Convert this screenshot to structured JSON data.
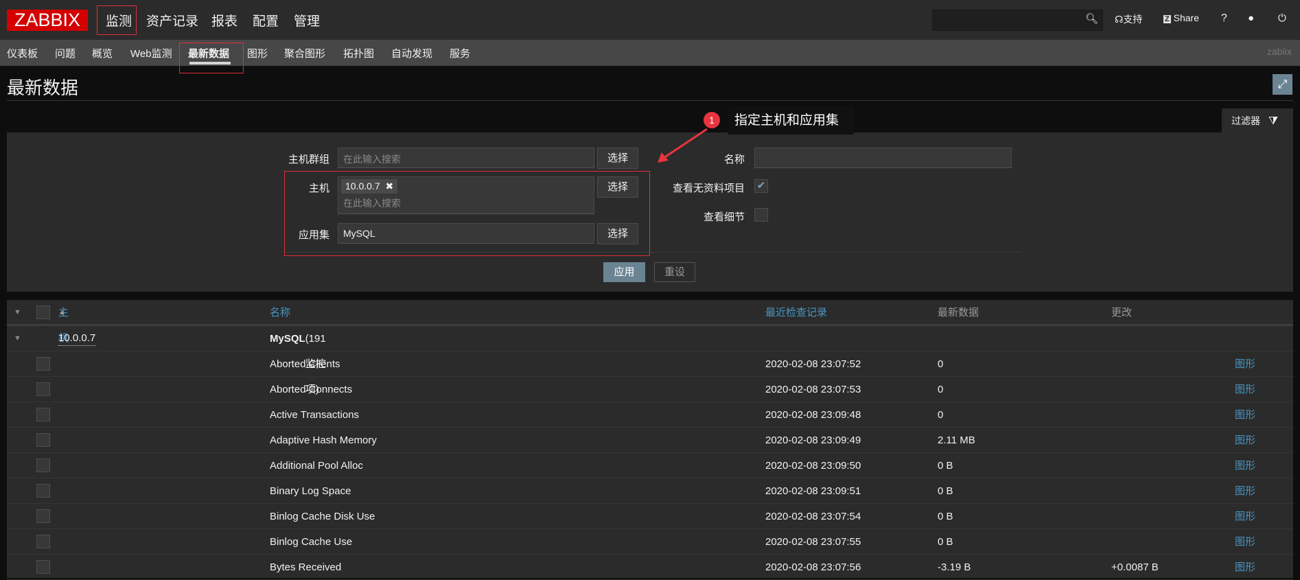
{
  "topbar": {
    "logo": "ZABBIX",
    "menu": [
      "监测",
      "资产记录",
      "报表",
      "配置",
      "管理"
    ],
    "support": "支持",
    "share": "Share",
    "help": "?"
  },
  "subnav": {
    "items": [
      "仪表板",
      "问题",
      "概览",
      "Web监测",
      "最新数据",
      "图形",
      "聚合图形",
      "拓扑图",
      "自动发现",
      "服务"
    ],
    "user": "zabiix"
  },
  "page": {
    "title": "最新数据"
  },
  "filter": {
    "tab": "过滤器",
    "hostgroup_label": "主机群组",
    "hostgroup_placeholder": "在此输入搜索",
    "select": "选择",
    "host_label": "主机",
    "host_tag": "10.0.0.7",
    "host_placeholder": "在此输入搜索",
    "app_label": "应用集",
    "app_value": "MySQL",
    "name_label": "名称",
    "name_value": "",
    "show_without_data_label": "查看无资料项目",
    "show_without_data": true,
    "show_details_label": "查看细节",
    "show_details": false,
    "apply": "应用",
    "reset": "重设"
  },
  "annotation": {
    "number": "1",
    "text": "指定主机和应用集"
  },
  "table": {
    "headers": {
      "host": "主机",
      "name": "名称",
      "lastcheck": "最近检查记录",
      "lastvalue": "最新数据",
      "change": "更改"
    },
    "group": {
      "host": "10.0.0.7",
      "app": "MySQL",
      "count": "(191 监控项)"
    },
    "rows": [
      {
        "name": "Aborted Clients",
        "lastcheck": "2020-02-08 23:07:52",
        "value": "0",
        "change": "",
        "graph": "图形"
      },
      {
        "name": "Aborted Connects",
        "lastcheck": "2020-02-08 23:07:53",
        "value": "0",
        "change": "",
        "graph": "图形"
      },
      {
        "name": "Active Transactions",
        "lastcheck": "2020-02-08 23:09:48",
        "value": "0",
        "change": "",
        "graph": "图形"
      },
      {
        "name": "Adaptive Hash Memory",
        "lastcheck": "2020-02-08 23:09:49",
        "value": "2.11 MB",
        "change": "",
        "graph": "图形"
      },
      {
        "name": "Additional Pool Alloc",
        "lastcheck": "2020-02-08 23:09:50",
        "value": "0 B",
        "change": "",
        "graph": "图形"
      },
      {
        "name": "Binary Log Space",
        "lastcheck": "2020-02-08 23:09:51",
        "value": "0 B",
        "change": "",
        "graph": "图形"
      },
      {
        "name": "Binlog Cache Disk Use",
        "lastcheck": "2020-02-08 23:07:54",
        "value": "0 B",
        "change": "",
        "graph": "图形"
      },
      {
        "name": "Binlog Cache Use",
        "lastcheck": "2020-02-08 23:07:55",
        "value": "0 B",
        "change": "",
        "graph": "图形"
      },
      {
        "name": "Bytes Received",
        "lastcheck": "2020-02-08 23:07:56",
        "value": "-3.19 B",
        "change": "+0.0087 B",
        "graph": "图形"
      }
    ]
  }
}
